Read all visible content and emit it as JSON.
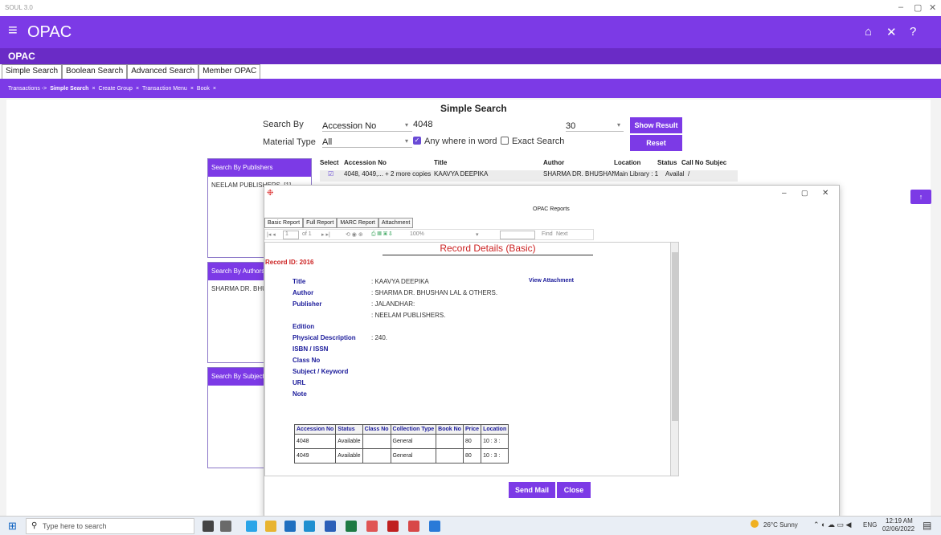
{
  "window": {
    "title": "SOUL 3.0"
  },
  "appbar": {
    "title": "OPAC"
  },
  "section": {
    "title": "OPAC"
  },
  "tabs": [
    "Simple Search",
    "Boolean Search",
    "Advanced Search",
    "Member OPAC"
  ],
  "breadcrumbs": [
    "Transactions ->",
    "Simple Search",
    "×",
    "Create Group",
    "×",
    "Transaction Menu",
    "×",
    "Book",
    "×"
  ],
  "search": {
    "heading": "Simple Search",
    "search_by_label": "Search By",
    "search_by_value": "Accession No",
    "query_value": "4048",
    "count_value": "30",
    "material_label": "Material Type",
    "material_value": "All",
    "anywhere_label": "Any where in word",
    "exact_label": "Exact Search",
    "show_result": "Show Result",
    "reset": "Reset"
  },
  "side": {
    "publishers_head": "Search By Publishers",
    "publishers_item": "NEELAM PUBLISHERS. [1]",
    "authors_head": "Search By Authors",
    "authors_item": "SHARMA DR. BHUS",
    "subjects_head": "Search By Subjects"
  },
  "grid": {
    "headers": [
      "Select",
      "Accession No",
      "Title",
      "Author",
      "Location",
      "Status",
      "Call No",
      "Subjec"
    ],
    "row": [
      "4048, 4049,... + 2 more copies",
      "KAAVYA DEEPIKA",
      "SHARMA DR. BHUSHAN",
      "Main Library : 1",
      "Availal",
      "/"
    ]
  },
  "modal": {
    "title": "OPAC Reports",
    "tabs": [
      "Basic Report",
      "Full Report",
      "MARC Report",
      "Attachment"
    ],
    "page": "1",
    "of": "of 1",
    "zoom": "100%",
    "find": "Find",
    "next": "Next",
    "report_title": "Record Details (Basic)",
    "record_id": "Record ID: 2016",
    "view_attachment": "View Attachment",
    "send_mail": "Send Mail",
    "close": "Close"
  },
  "fields": [
    {
      "k": "Title",
      "v": ": KAAVYA DEEPIKA"
    },
    {
      "k": "Author",
      "v": ": SHARMA DR. BHUSHAN LAL & OTHERS."
    },
    {
      "k": "Publisher",
      "v": ": JALANDHAR:"
    },
    {
      "k": "",
      "v": ": NEELAM PUBLISHERS."
    },
    {
      "k": "Edition",
      "v": ""
    },
    {
      "k": "Physical Description",
      "v": ": 240."
    },
    {
      "k": "ISBN / ISSN",
      "v": ""
    },
    {
      "k": "Class No",
      "v": ""
    },
    {
      "k": "Subject / Keyword",
      "v": ""
    },
    {
      "k": "URL",
      "v": ""
    },
    {
      "k": "Note",
      "v": ""
    }
  ],
  "holdings": {
    "headers": [
      "Accession No",
      "Status",
      "Class No",
      "Collection Type",
      "Book No",
      "Price",
      "Location"
    ],
    "rows": [
      [
        "4048",
        "Available",
        "",
        "General",
        "",
        "80",
        "10 : 3 :"
      ],
      [
        "4049",
        "Available",
        "",
        "General",
        "",
        "80",
        "10 : 3 :"
      ]
    ]
  },
  "taskbar": {
    "search": "Type here to search",
    "weather": "26°C Sunny",
    "lang": "ENG",
    "time": "12:19 AM",
    "date": "02/06/2022"
  }
}
